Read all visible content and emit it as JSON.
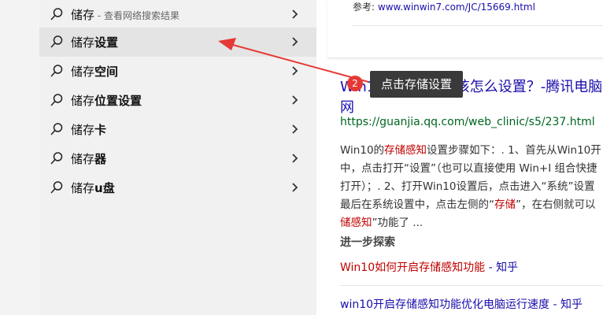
{
  "search_panel": {
    "items": [
      {
        "prefix": "储存",
        "bold": "",
        "sub": " - 查看网络搜索结果"
      },
      {
        "prefix": "储存",
        "bold": "设置",
        "sub": ""
      },
      {
        "prefix": "储存",
        "bold": "空间",
        "sub": ""
      },
      {
        "prefix": "储存",
        "bold": "位置设置",
        "sub": ""
      },
      {
        "prefix": "储存",
        "bold": "卡",
        "sub": ""
      },
      {
        "prefix": "储存",
        "bold": "器",
        "sub": ""
      },
      {
        "prefix": "储存",
        "bold": "u盘",
        "sub": ""
      }
    ]
  },
  "results": {
    "ref_prefix": "参考:",
    "ref_url": "www.winwin7.com/JC/15669.html",
    "title_line1": "Win10存储感知应该怎么设置？-腾讯电脑",
    "title_line2": "网",
    "url": "https://guanjia.qq.com/web_clinic/s5/237.html",
    "snippet": {
      "p1": "Win10的",
      "h1": "存储感知",
      "p2": "设置步骤如下：. 1、首先从Win10开",
      "p3": "中，点击打开“设置”（也可以直接使用 Win+I 组合快捷",
      "p4": "打开）；. 2、打开Win10设置后，点击进入“系统”设置",
      "p5": "最后在系统设置中，点击左侧的“",
      "h2": "存储",
      "p6": "”，在右侧就可以",
      "h3": "储感知",
      "p7": "”功能了 ..."
    },
    "explore_heading": "进一步探索",
    "link1_red": "Win10如何开启存储感知功能",
    "link1_blue": " - 知乎",
    "link2_blue": "win10开启存储感知功能优化电脑运行速度 - 知乎"
  },
  "annotation": {
    "badge": "2",
    "tooltip": "点击存储设置"
  },
  "colors": {
    "link": "#1a0dab",
    "url": "#006621",
    "highlight": "#c00000",
    "arrow": "#e53935"
  }
}
